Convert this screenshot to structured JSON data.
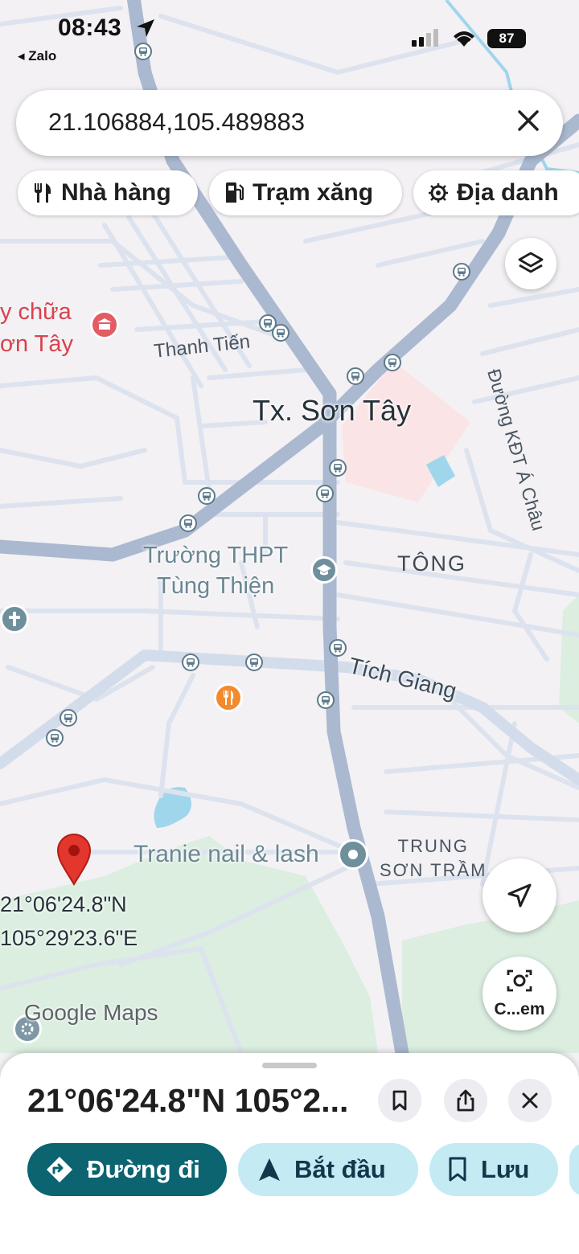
{
  "status_bar": {
    "time": "08:43",
    "back_app": "◂ Zalo",
    "battery": "87"
  },
  "search": {
    "value": "21.106884,105.489883"
  },
  "chips": [
    {
      "label": "Nhà hàng",
      "icon": "restaurant-icon"
    },
    {
      "label": "Trạm xăng",
      "icon": "gas-station-icon"
    },
    {
      "label": "Địa danh",
      "icon": "landmark-icon"
    }
  ],
  "map": {
    "labels": {
      "museum_line1": "y chữa",
      "museum_line2": "ơn Tây",
      "thanh_tien": "Thanh Tiến",
      "town": "Tx. Sơn Tây",
      "road_kdt": "Đường KĐT Á Châu",
      "school_line1": "Trường THPT",
      "school_line2": "Tùng Thiện",
      "tong": "TÔNG",
      "tich_giang": "Tích Giang",
      "tranie": "Tranie nail & lash",
      "trung_line1": "TRUNG",
      "trung_line2": "SƠN TRẦM",
      "pin_lat": "21°06'24.8\"N",
      "pin_lng": "105°29'23.6\"E",
      "watermark": "Google Maps"
    },
    "colors": {
      "land": "#f3f1f4",
      "major_road": "#aab9d0",
      "minor_road": "#dde3ee",
      "park": "#dbeee0",
      "water": "#9fd6ec",
      "pin": "#e3362d"
    }
  },
  "lens_button": {
    "label": "C...em"
  },
  "sheet": {
    "title": "21°06'24.8\"N 105°2...",
    "actions": [
      {
        "label": "Đường đi",
        "icon": "directions-icon"
      },
      {
        "label": "Bắt đầu",
        "icon": "navigation-arrow-icon"
      },
      {
        "label": "Lưu",
        "icon": "bookmark-icon"
      }
    ]
  }
}
